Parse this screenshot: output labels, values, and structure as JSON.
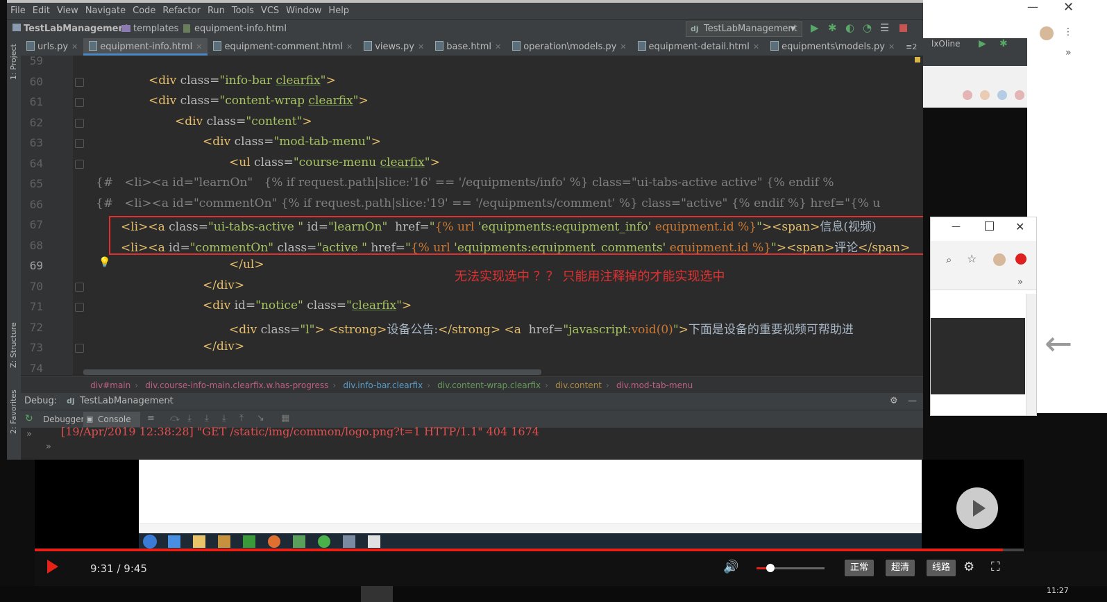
{
  "ide": {
    "menu": [
      "File",
      "Edit",
      "View",
      "Navigate",
      "Code",
      "Refactor",
      "Run",
      "Tools",
      "VCS",
      "Window",
      "Help"
    ],
    "breadcrumb": {
      "project": "TestLabManagement",
      "folder": "templates",
      "file": "equipment-info.html"
    },
    "run_config": "TestLabManagement",
    "tabs": [
      {
        "label": "urls.py",
        "active": false
      },
      {
        "label": "equipment-info.html",
        "active": true
      },
      {
        "label": "equipment-comment.html",
        "active": false
      },
      {
        "label": "views.py",
        "active": false
      },
      {
        "label": "base.html",
        "active": false
      },
      {
        "label": "operation\\models.py",
        "active": false
      },
      {
        "label": "equipment-detail.html",
        "active": false
      },
      {
        "label": "equipments\\models.py",
        "active": false
      }
    ],
    "tabs_overflow": "≡2",
    "side_panels": {
      "project": "1: Project",
      "structure": "Z: Structure",
      "favorites": "2: Favorites"
    },
    "line_numbers": [
      "59",
      "60",
      "61",
      "62",
      "63",
      "64",
      "65",
      "66",
      "67",
      "68",
      "69",
      "70",
      "71",
      "72",
      "73",
      "74"
    ],
    "annotation": "无法实现选中 ？？ 只能用注释掉的才能实现选中",
    "path": [
      "div#main",
      "div.course-info-main.clearfix.w.has-progress",
      "div.info-bar.clearfix",
      "div.content-wrap.clearfix",
      "div.content",
      "div.mod-tab-menu"
    ],
    "debug": {
      "label": "Debug:",
      "config": "TestLabManagement",
      "debugger_tab": "Debugger",
      "console_tab": "Console"
    },
    "console_line": "[19/Apr/2019 12:38:28] \"GET /static/img/common/logo.png?t=1 HTTP/1.1\" 404 1674"
  },
  "chrome2_tab_hint": "lxOline",
  "video": {
    "time": "9:31 / 9:45",
    "quality": [
      "正常",
      "超清",
      "线路"
    ],
    "progress": 0.979
  },
  "clock": "11:27",
  "colors": {
    "accent_red": "#e03030",
    "tab_active": "#4a88c7",
    "progress": "#e62117"
  }
}
